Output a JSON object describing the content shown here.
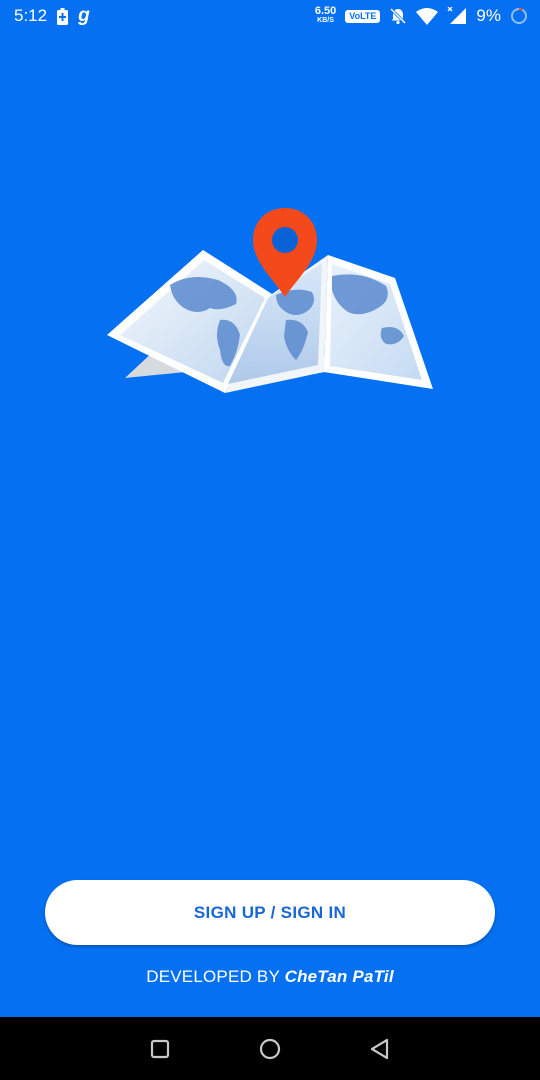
{
  "status_bar": {
    "time": "5:12",
    "net_speed_value": "6.50",
    "net_speed_unit": "KB/S",
    "volte": "VoLTE",
    "battery_percent": "9%",
    "icons": [
      "battery-charging-icon",
      "g-app-icon",
      "mute-icon",
      "wifi-icon",
      "signal-icon",
      "battery-ring-icon"
    ]
  },
  "hero": {
    "image": "world-map-with-location-pin"
  },
  "actions": {
    "auth_button_label": "SIGN UP / SIGN IN"
  },
  "footer": {
    "credit_prefix": "DEVELOPED BY ",
    "credit_name": "CheTan PaTil"
  },
  "nav_bar": {
    "icons": [
      "recents-icon",
      "home-icon",
      "back-icon"
    ]
  },
  "colors": {
    "background": "#0571F2",
    "button_text": "#1867D6",
    "pin": "#F44A1B"
  }
}
